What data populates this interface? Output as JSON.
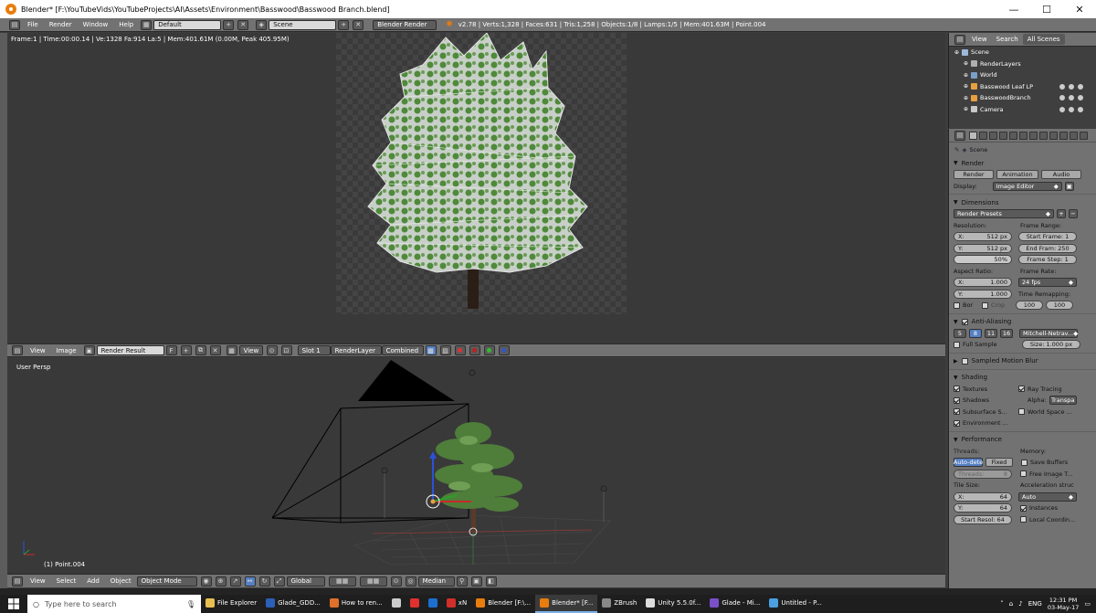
{
  "window": {
    "title": "Blender* [F:\\YouTubeVids\\YouTubeProjects\\AI\\Assets\\Environment\\Basswood\\Basswood Branch.blend]",
    "minimize": "—",
    "maximize": "☐",
    "close": "✕"
  },
  "info_header": {
    "menus": [
      "File",
      "Render",
      "Window",
      "Help"
    ],
    "layout": "Default",
    "scene": "Scene",
    "engine": "Blender Render",
    "stats": "v2.78 | Verts:1,328 | Faces:631 | Tris:1,258 | Objects:1/8 | Lamps:1/5 | Mem:401.63M | Point.004"
  },
  "image_editor": {
    "frame_info": "Frame:1 | Time:00:00.14 | Ve:1328 Fa:914 La:5 | Mem:401.61M (0.00M, Peak 405.95M)",
    "header": {
      "view": "View",
      "image": "Image",
      "image_name": "Render Result",
      "fake_user": "F",
      "view2": "View",
      "slot": "Slot 1",
      "layer": "RenderLayer",
      "pass": "Combined"
    }
  },
  "viewport": {
    "persp_label": "User Persp",
    "object_label": "(1) Point.004",
    "header": {
      "view": "View",
      "select": "Select",
      "add": "Add",
      "object": "Object",
      "mode": "Object Mode",
      "orientation": "Global",
      "pivot": "Median"
    }
  },
  "outliner": {
    "tabs": [
      "View",
      "Search",
      "All Scenes"
    ],
    "items": [
      {
        "label": "Scene",
        "indent": 0,
        "icon_color": "#9bb8d8"
      },
      {
        "label": "RenderLayers",
        "indent": 1,
        "icon_color": "#b0b0b0"
      },
      {
        "label": "World",
        "indent": 1,
        "icon_color": "#7aa0c8"
      },
      {
        "label": "Basswood Leaf LP",
        "indent": 1,
        "icon_color": "#e8a040"
      },
      {
        "label": "BasswoodBranch",
        "indent": 1,
        "icon_color": "#e8a040"
      },
      {
        "label": "Camera",
        "indent": 1,
        "icon_color": "#c8c8c8"
      }
    ]
  },
  "properties": {
    "context": "Scene",
    "render": {
      "title": "Render",
      "btn_render": "Render",
      "btn_animation": "Animation",
      "btn_audio": "Audio",
      "display_label": "Display:",
      "display_value": "Image Editor"
    },
    "dimensions": {
      "title": "Dimensions",
      "presets": "Render Presets",
      "resolution_label": "Resolution:",
      "res_x": "512 px",
      "res_y": "512 px",
      "res_pct": "50%",
      "frame_range_label": "Frame Range:",
      "start": "Start Frame: 1",
      "end": "End Fram: 250",
      "step": "Frame Step: 1",
      "aspect_label": "Aspect Ratio:",
      "asp_x": "1.000",
      "asp_y": "1.000",
      "frame_rate_label": "Frame Rate:",
      "fps": "24 fps",
      "remap_label": "Time Remapping:",
      "remap_old": "100",
      "remap_new": "100",
      "bor": "Bor",
      "crop": "Crop",
      "x_label": "X:",
      "y_label": "Y:"
    },
    "antialiasing": {
      "title": "Anti-Aliasing",
      "samples": [
        "5",
        "8",
        "11",
        "16"
      ],
      "filter": "Mitchell-Netrav...",
      "full_sample": "Full Sample",
      "size": "Size: 1.000 px"
    },
    "motion_blur": {
      "title": "Sampled Motion Blur"
    },
    "shading": {
      "title": "Shading",
      "textures": "Textures",
      "ray_tracing": "Ray Tracing",
      "shadows": "Shadows",
      "alpha_label": "Alpha:",
      "alpha_value": "Transpa",
      "sss": "Subsurface S...",
      "world_space": "World Space ...",
      "environment": "Environment ..."
    },
    "performance": {
      "title": "Performance",
      "threads_label": "Threads:",
      "auto": "Auto-dete",
      "fixed": "Fixed",
      "threads_val": "Threads:",
      "threads_num": "8",
      "memory_label": "Memory:",
      "save_buffers": "Save Buffers",
      "free_image": "Free Image T...",
      "tile_label": "Tile Size:",
      "tile_x": "64",
      "tile_y": "64",
      "accel_label": "Acceleration struc",
      "accel_value": "Auto",
      "instances": "Instances",
      "start_resol": "Start Resol: 64",
      "local_coord": "Local Coordin..."
    }
  },
  "taskbar": {
    "search_placeholder": "Type here to search",
    "apps": [
      {
        "label": "File Explorer",
        "color": "#e8c050",
        "active": false
      },
      {
        "label": "Glade_GDD...",
        "color": "#2b5fb8",
        "active": false
      },
      {
        "label": "How to ren...",
        "color": "#e0702a",
        "active": false
      },
      {
        "label": "",
        "color": "#cccccc",
        "active": false
      },
      {
        "label": "",
        "color": "#e03030",
        "active": false
      },
      {
        "label": "",
        "color": "#1c6fd1",
        "active": false
      },
      {
        "label": "xN",
        "color": "#d0302a",
        "active": false
      },
      {
        "label": "Blender [F:\\...",
        "color": "#e87d0d",
        "active": false
      },
      {
        "label": "Blender* [F...",
        "color": "#e87d0d",
        "active": true
      },
      {
        "label": "ZBrush",
        "color": "#888888",
        "active": false
      },
      {
        "label": "Unity 5.5.0f...",
        "color": "#dddddd",
        "active": false
      },
      {
        "label": "Glade - Mi...",
        "color": "#7a4fc9",
        "active": false
      },
      {
        "label": "Untitled - P...",
        "color": "#4aa0e0",
        "active": false
      }
    ],
    "lang": "ENG",
    "time": "12:31 PM",
    "date": "03-May-17"
  },
  "colors": {
    "blender_orange": "#e87d0d",
    "editor_bg": "#393939",
    "header_gray": "#727272",
    "leaf_green": "#4f8a3a"
  }
}
